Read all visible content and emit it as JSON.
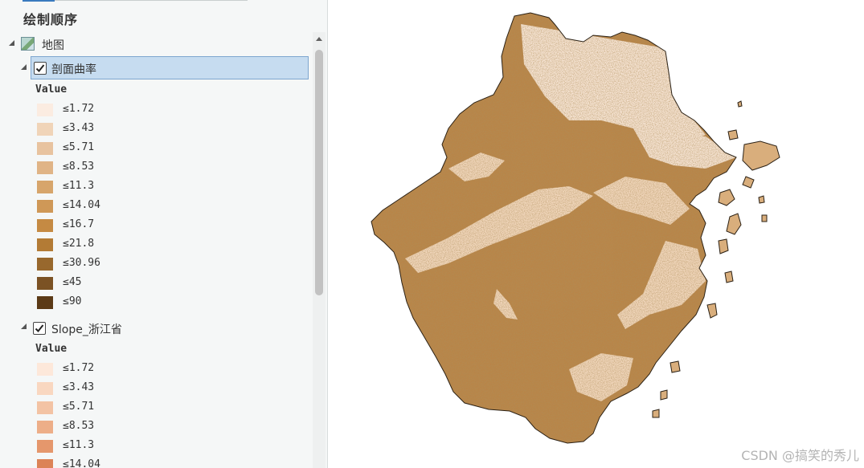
{
  "pane": {
    "title": "绘制顺序",
    "map_label": "地图",
    "value_header": "Value"
  },
  "layers": [
    {
      "name": "剖面曲率",
      "checked": true,
      "selected": true,
      "legend": [
        {
          "label": "≤1.72",
          "color": "#fbece1"
        },
        {
          "label": "≤3.43",
          "color": "#f0d4b8"
        },
        {
          "label": "≤5.71",
          "color": "#e8c39f"
        },
        {
          "label": "≤8.53",
          "color": "#e0b486"
        },
        {
          "label": "≤11.3",
          "color": "#d7a56b"
        },
        {
          "label": "≤14.04",
          "color": "#cf9857"
        },
        {
          "label": "≤16.7",
          "color": "#c58a43"
        },
        {
          "label": "≤21.8",
          "color": "#b37b35"
        },
        {
          "label": "≤30.96",
          "color": "#98682d"
        },
        {
          "label": "≤45",
          "color": "#7b5224"
        },
        {
          "label": "≤90",
          "color": "#5b3a16"
        }
      ]
    },
    {
      "name": "Slope_浙江省",
      "checked": true,
      "selected": false,
      "legend": [
        {
          "label": "≤1.72",
          "color": "#fde8da"
        },
        {
          "label": "≤3.43",
          "color": "#f9d7c0"
        },
        {
          "label": "≤5.71",
          "color": "#f3c3a4"
        },
        {
          "label": "≤8.53",
          "color": "#edae88"
        },
        {
          "label": "≤11.3",
          "color": "#e5976c"
        },
        {
          "label": "≤14.04",
          "color": "#dc8357"
        }
      ]
    }
  ],
  "map": {
    "region_light_color": "#f8e6d6",
    "region_dark_color": "#b98548",
    "outline_color": "#2b2115"
  },
  "watermark": "CSDN @搞笑的秀儿"
}
